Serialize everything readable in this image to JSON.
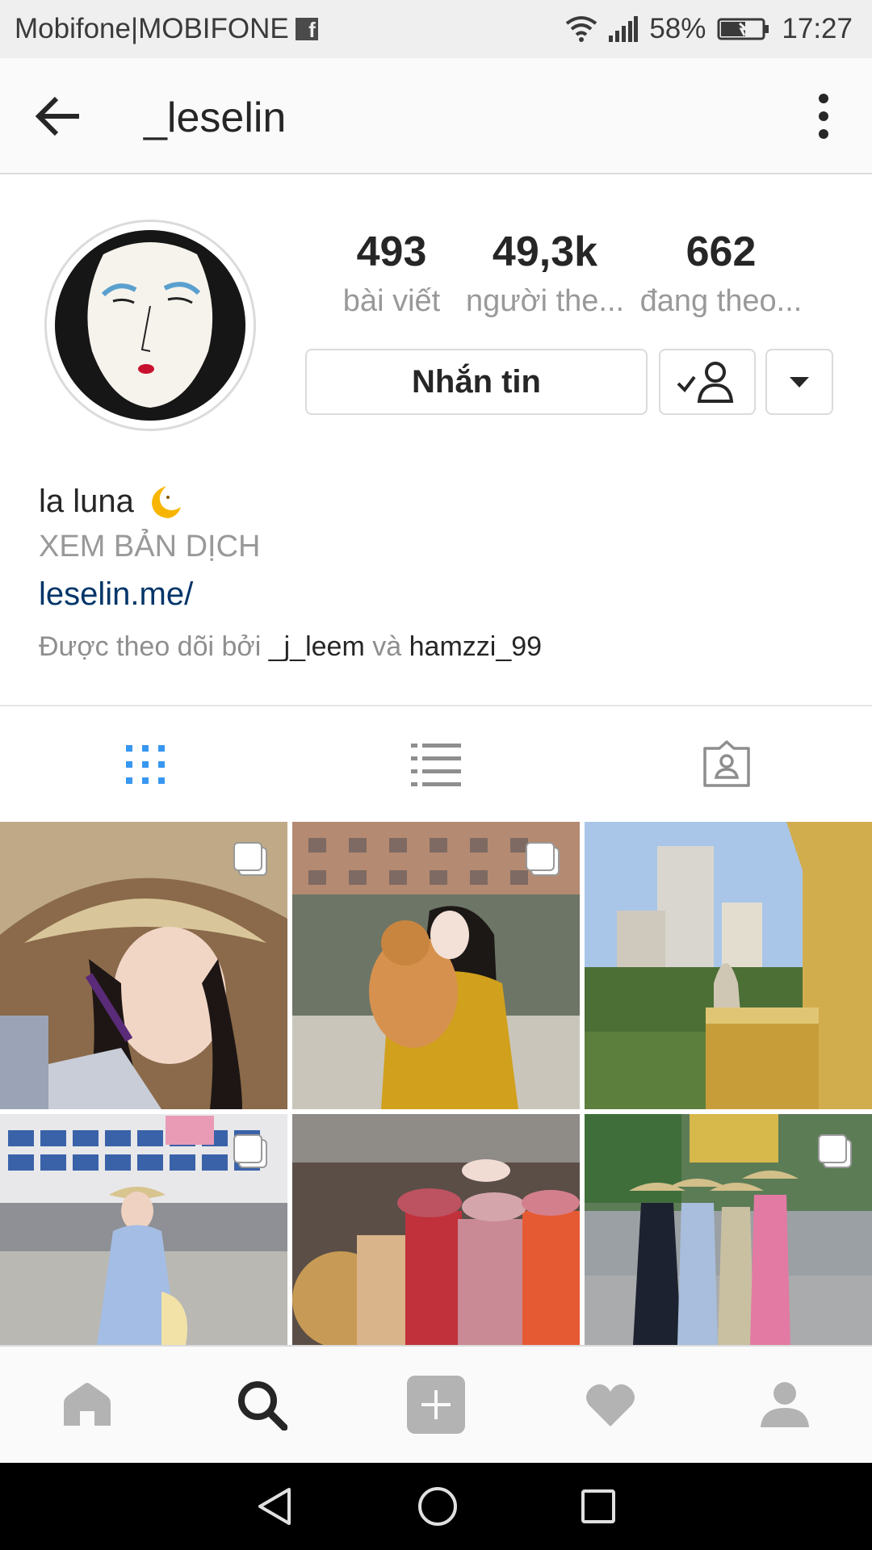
{
  "status_bar": {
    "carrier": "Mobifone|MOBIFONE",
    "battery": "58%",
    "time": "17:27",
    "icons": [
      "facebook-icon",
      "wifi-icon",
      "signal-icon",
      "battery-charging-icon"
    ]
  },
  "header": {
    "username": "_leselin",
    "icons": [
      "back-arrow-icon",
      "more-vertical-icon"
    ]
  },
  "profile": {
    "stats": [
      {
        "value": "493",
        "label": "bài viết"
      },
      {
        "value": "49,3k",
        "label": "người the..."
      },
      {
        "value": "662",
        "label": "đang theo..."
      }
    ],
    "message_button": "Nhắn tin",
    "name": "la luna",
    "name_emoji": "🌛",
    "translate_label": "XEM BẢN DỊCH",
    "link": "leselin.me/",
    "followed_by": {
      "prefix": "Được theo dõi bởi",
      "user1": "_j_leem",
      "joiner": "và",
      "user2": "hamzzi_99"
    }
  },
  "tabs": [
    "grid-icon",
    "list-icon",
    "tagged-icon"
  ],
  "colors": {
    "accent": "#3897f0",
    "link": "#003569",
    "muted": "#999999",
    "border": "#dbdbdb"
  },
  "bottom_nav": [
    "home-icon",
    "search-icon",
    "add-post-icon",
    "heart-icon",
    "profile-icon"
  ],
  "system_nav": [
    "back-triangle-icon",
    "home-circle-icon",
    "recents-square-icon"
  ]
}
